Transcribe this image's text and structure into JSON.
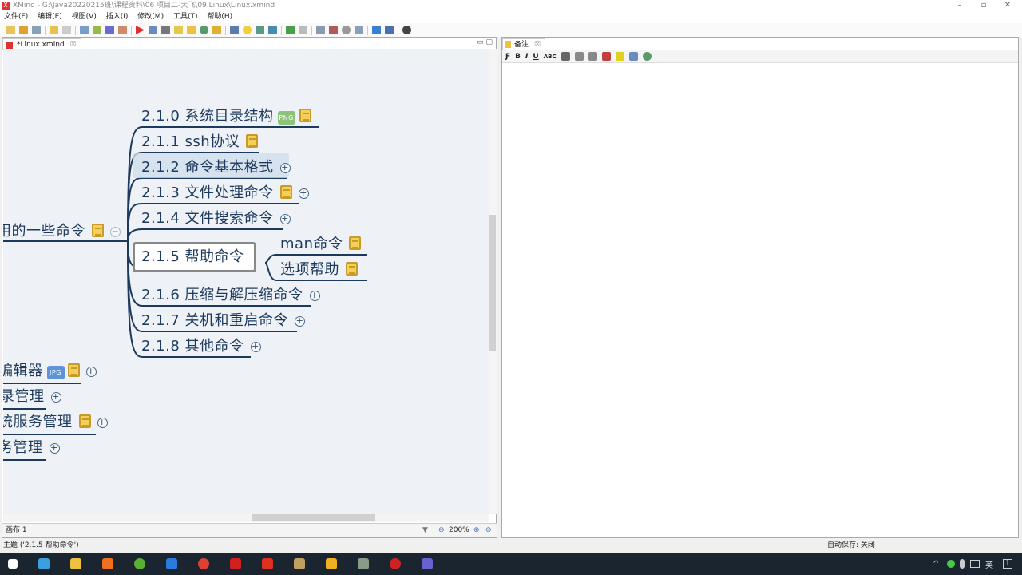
{
  "window": {
    "title": "XMind - G:\\Java20220215班\\课程资料\\06 项目二-大飞\\09.Linux\\Linux.xmind",
    "logo": "X"
  },
  "menu": [
    "文件(F)",
    "编辑(E)",
    "视图(V)",
    "插入(I)",
    "修改(M)",
    "工具(T)",
    "帮助(H)"
  ],
  "editor_tab": "*Linux.xmind",
  "notes_tab": "备注",
  "notes_toolbar": [
    "Ƒ",
    "B",
    "I",
    "U",
    "ABC"
  ],
  "mindmap": {
    "parent": {
      "label": "用的一些命令",
      "expand": "−"
    },
    "children": [
      {
        "label": "2.1.0  系统目录结构",
        "image": "PNG",
        "note": true,
        "plus": false
      },
      {
        "label": "2.1.1  ssh协议",
        "note": true,
        "plus": false
      },
      {
        "label": "2.1.2  命令基本格式",
        "note": false,
        "plus": true
      },
      {
        "label": "2.1.3  文件处理命令",
        "note": true,
        "plus": true
      },
      {
        "label": "2.1.4  文件搜索命令",
        "note": false,
        "plus": true
      },
      {
        "label": "2.1.5  帮助命令",
        "note": false,
        "plus": false
      },
      {
        "label": "2.1.6  压缩与解压缩命令",
        "note": false,
        "plus": true
      },
      {
        "label": "2.1.7  关机和重启命令",
        "note": false,
        "plus": true
      },
      {
        "label": "2.1.8  其他命令",
        "note": false,
        "plus": true
      }
    ],
    "help_children": [
      {
        "label": "man命令"
      },
      {
        "label": "选项帮助"
      }
    ],
    "left_topics": [
      {
        "label": "编辑器",
        "image": "JPG",
        "note": true
      },
      {
        "label": "录管理"
      },
      {
        "label": "统服务管理",
        "note": true
      },
      {
        "label": "务管理"
      }
    ],
    "plus_glyph": "+"
  },
  "canvas_bar": {
    "sheet": "画布 1",
    "zoom": "200%"
  },
  "status": {
    "selection": "主题 ('2.1.5 帮助命令')",
    "autosave": "自动保存: 关闭"
  },
  "tray": {
    "lang": "英",
    "notif": "1"
  }
}
